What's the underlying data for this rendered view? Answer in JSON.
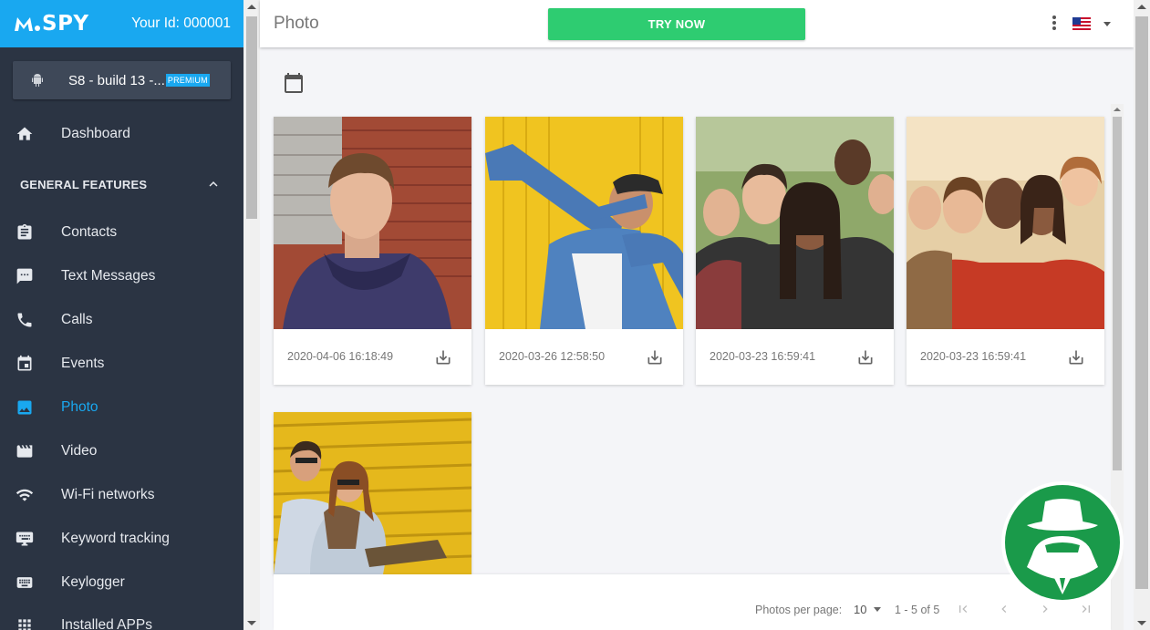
{
  "sidebar": {
    "logo": "SPY",
    "user_id": "Your Id: 000001",
    "device": {
      "name": "S8 - build 13 -...",
      "badge": "PREMIUM",
      "icon": "android-icon"
    },
    "dashboard": {
      "label": "Dashboard",
      "icon": "home-icon"
    },
    "section_title": "GENERAL FEATURES",
    "items": [
      {
        "label": "Contacts",
        "icon": "clipboard-icon"
      },
      {
        "label": "Text Messages",
        "icon": "message-icon"
      },
      {
        "label": "Calls",
        "icon": "phone-icon"
      },
      {
        "label": "Events",
        "icon": "calendar-icon"
      },
      {
        "label": "Photo",
        "icon": "image-icon",
        "active": true
      },
      {
        "label": "Video",
        "icon": "film-icon"
      },
      {
        "label": "Wi-Fi networks",
        "icon": "wifi-icon"
      },
      {
        "label": "Keyword tracking",
        "icon": "keyboard-icon"
      },
      {
        "label": "Keylogger",
        "icon": "keyboard-icon"
      },
      {
        "label": "Installed APPs",
        "icon": "apps-grid-icon"
      }
    ]
  },
  "header": {
    "title": "Photo",
    "try_now": "TRY NOW",
    "language_flag": "us-flag-icon"
  },
  "gallery": {
    "photos": [
      {
        "date": "2020-04-06 16:18:49"
      },
      {
        "date": "2020-03-26 12:58:50"
      },
      {
        "date": "2020-03-23 16:59:41"
      },
      {
        "date": "2020-03-23 16:59:41"
      },
      {
        "date": ""
      }
    ]
  },
  "pagination": {
    "per_page_label": "Photos per page:",
    "per_page_value": "10",
    "range": "1 - 5 of 5"
  },
  "colors": {
    "brand": "#19a8f0",
    "sidebar_bg": "#2b3443",
    "try_now": "#2ecc71",
    "badge": "#1a9a4a"
  }
}
